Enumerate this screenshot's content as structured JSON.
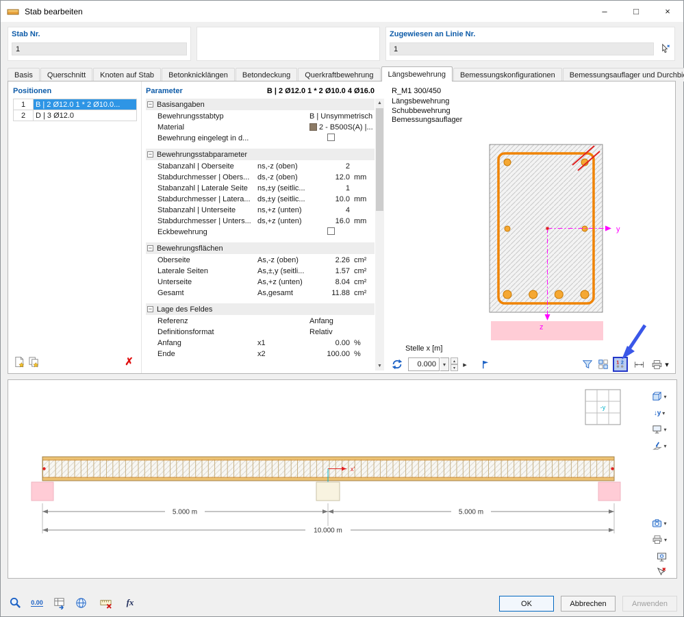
{
  "window": {
    "title": "Stab bearbeiten"
  },
  "window_controls": {
    "minimize": "–",
    "maximize": "□",
    "close": "×"
  },
  "header": {
    "stab_nr": {
      "label": "Stab Nr.",
      "value": "1"
    },
    "assigned_line": {
      "label": "Zugewiesen an Linie Nr.",
      "value": "1"
    }
  },
  "tabs": {
    "active": "Längsbewehrung",
    "items": [
      "Basis",
      "Querschnitt",
      "Knoten auf Stab",
      "Betonknicklängen",
      "Betondeckung",
      "Querkraftbewehrung",
      "Längsbewehrung",
      "Bemessungskonfigurationen",
      "Bemessungsauflager und Durchbiegung"
    ]
  },
  "positions": {
    "title": "Positionen",
    "rows": [
      {
        "nr": "1",
        "desc": "B | 2 Ø12.0 1 * 2 Ø10.0...",
        "selected": true
      },
      {
        "nr": "2",
        "desc": "D | 3 Ø12.0",
        "selected": false
      }
    ]
  },
  "parameters": {
    "title": "Parameter",
    "summary": "B | 2 Ø12.0 1 * 2 Ø10.0 4 Ø16.0",
    "groups": [
      {
        "label": "Basisangaben",
        "rows": [
          {
            "label": "Bewehrungsstabtyp",
            "sym": "",
            "value": "B | Unsymmetrisch",
            "unit": "",
            "type": "text"
          },
          {
            "label": "Material",
            "sym": "",
            "value": "2 - B500S(A) |...",
            "unit": "",
            "type": "material"
          },
          {
            "label": "Bewehrung eingelegt in d...",
            "sym": "",
            "value": "",
            "unit": "",
            "type": "checkbox"
          }
        ]
      },
      {
        "label": "Bewehrungsstabparameter",
        "rows": [
          {
            "label": "Stabanzahl | Oberseite",
            "sym": "ns,-z (oben)",
            "value": "2",
            "unit": "",
            "type": "number"
          },
          {
            "label": "Stabdurchmesser | Obers...",
            "sym": "ds,-z (oben)",
            "value": "12.0",
            "unit": "mm",
            "type": "number"
          },
          {
            "label": "Stabanzahl | Laterale Seite",
            "sym": "ns,±y (seitlic...",
            "value": "1",
            "unit": "",
            "type": "number"
          },
          {
            "label": "Stabdurchmesser | Latera...",
            "sym": "ds,±y (seitlic...",
            "value": "10.0",
            "unit": "mm",
            "type": "number"
          },
          {
            "label": "Stabanzahl | Unterseite",
            "sym": "ns,+z (unten)",
            "value": "4",
            "unit": "",
            "type": "number"
          },
          {
            "label": "Stabdurchmesser | Unters...",
            "sym": "ds,+z (unten)",
            "value": "16.0",
            "unit": "mm",
            "type": "number"
          },
          {
            "label": "Eckbewehrung",
            "sym": "",
            "value": "",
            "unit": "",
            "type": "checkbox"
          }
        ]
      },
      {
        "label": "Bewehrungsflächen",
        "rows": [
          {
            "label": "Oberseite",
            "sym": "As,-z (oben)",
            "value": "2.26",
            "unit": "cm²",
            "type": "number"
          },
          {
            "label": "Laterale Seiten",
            "sym": "As,±,y (seitli...",
            "value": "1.57",
            "unit": "cm²",
            "type": "number"
          },
          {
            "label": "Unterseite",
            "sym": "As,+z (unten)",
            "value": "8.04",
            "unit": "cm²",
            "type": "number"
          },
          {
            "label": "Gesamt",
            "sym": "As,gesamt",
            "value": "11.88",
            "unit": "cm²",
            "type": "number"
          }
        ]
      },
      {
        "label": "Lage des Feldes",
        "rows": [
          {
            "label": "Referenz",
            "sym": "",
            "value": "Anfang",
            "unit": "",
            "type": "text"
          },
          {
            "label": "Definitionsformat",
            "sym": "",
            "value": "Relativ",
            "unit": "",
            "type": "text"
          },
          {
            "label": "Anfang",
            "sym": "x1",
            "value": "0.00",
            "unit": "%",
            "type": "number"
          },
          {
            "label": "Ende",
            "sym": "x2",
            "value": "100.00",
            "unit": "%",
            "type": "number"
          }
        ]
      }
    ]
  },
  "preview": {
    "section_name": "R_M1 300/450",
    "legend": [
      "Längsbewehrung",
      "Schubbewehrung",
      "Bemessungsauflager"
    ],
    "location_label": "Stelle x [m]",
    "location_value": "0.000",
    "axis_y": "y",
    "axis_z": "z"
  },
  "elevation": {
    "dim_left": "5.000 m",
    "dim_right": "5.000 m",
    "dim_total": "10.000 m",
    "axis_x": "x'",
    "axis_z": "z'",
    "view_label": "-y"
  },
  "footer": {
    "ok": "OK",
    "cancel": "Abbrechen",
    "apply": "Anwenden"
  },
  "icons": {
    "chevron": "▾",
    "up": "▴",
    "down": "▾",
    "play": "▸",
    "collapse": "−",
    "delete": "✗",
    "decimal": "0.00",
    "fx": "fx",
    "view_direction": "↓y",
    "scroll_up": "▲",
    "scroll_down": "▼"
  },
  "colors": {
    "accent_blue": "#0d5ba8",
    "selection": "#2e95e5",
    "rebar_orange": "#f08300",
    "axis_magenta": "#ff00ff",
    "support_pink": "#ffccd6",
    "annotation_blue": "#3a57e8"
  }
}
